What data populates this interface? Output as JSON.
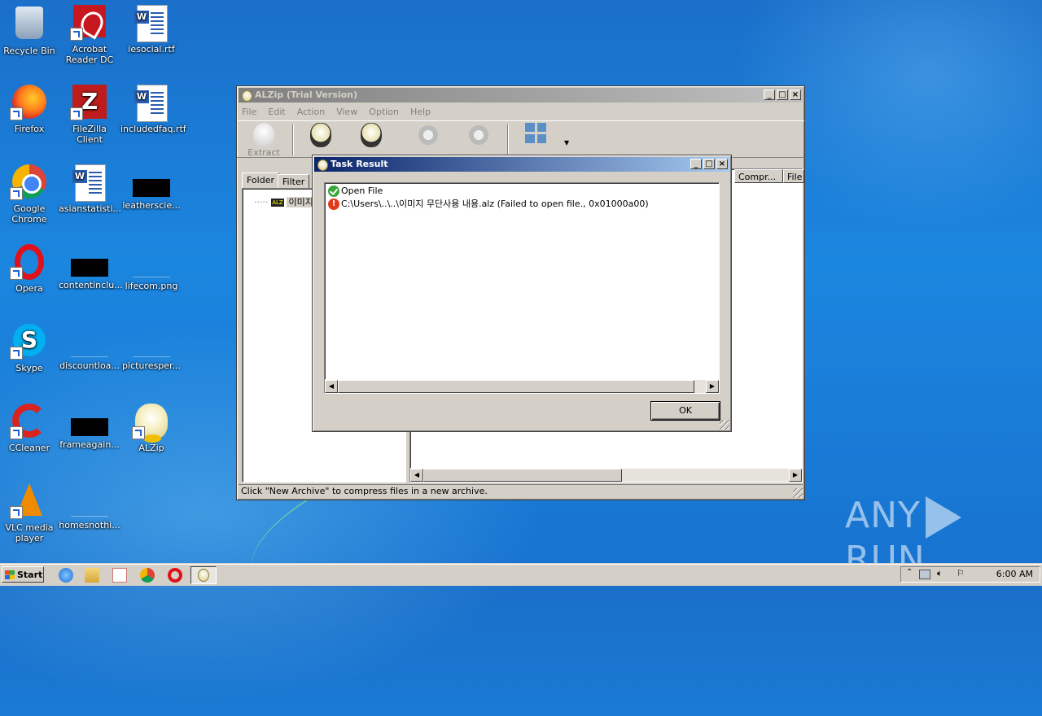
{
  "desktop": {
    "icons": [
      {
        "label": "Recycle Bin",
        "icon": "recycle-bin-icon"
      },
      {
        "label": "Acrobat Reader DC",
        "icon": "acrobat-icon"
      },
      {
        "label": "iesocial.rtf",
        "icon": "word-document-icon"
      },
      {
        "label": "Firefox",
        "icon": "firefox-icon"
      },
      {
        "label": "FileZilla Client",
        "icon": "filezilla-icon"
      },
      {
        "label": "includedfaq.rtf",
        "icon": "word-document-icon"
      },
      {
        "label": "Google Chrome",
        "icon": "chrome-icon"
      },
      {
        "label": "asianstatisti...",
        "icon": "word-document-icon"
      },
      {
        "label": "leatherscie...",
        "icon": "file-icon"
      },
      {
        "label": "Opera",
        "icon": "opera-icon"
      },
      {
        "label": "contentinclu...",
        "icon": "file-icon"
      },
      {
        "label": "lifecom.png",
        "icon": "image-file-icon"
      },
      {
        "label": "Skype",
        "icon": "skype-icon"
      },
      {
        "label": "discountloa...",
        "icon": "file-icon"
      },
      {
        "label": "picturesper...",
        "icon": "file-icon"
      },
      {
        "label": "CCleaner",
        "icon": "ccleaner-icon"
      },
      {
        "label": "frameagain...",
        "icon": "file-icon"
      },
      {
        "label": "ALZip",
        "icon": "alzip-icon"
      },
      {
        "label": "VLC media player",
        "icon": "vlc-icon"
      },
      {
        "label": "homesnothi...",
        "icon": "file-icon"
      }
    ]
  },
  "alzip": {
    "title": "ALZip (Trial Version)",
    "menu": [
      "File",
      "Edit",
      "Action",
      "View",
      "Option",
      "Help"
    ],
    "toolbar": {
      "extract_label": "Extract"
    },
    "tabs": {
      "folder": "Folder",
      "filter": "Filter"
    },
    "tree_item": "이미지",
    "columns": {
      "compressed": "Compr...",
      "file": "File"
    },
    "status": "Click \"New Archive\" to compress files in a new archive."
  },
  "task_result": {
    "title": "Task Result",
    "lines": [
      {
        "status": "ok",
        "text": "Open File"
      },
      {
        "status": "error",
        "text": "C:\\Users\\..\\..\\이미지 무단사용 내용.alz (Failed to open file., 0x01000a00)"
      }
    ],
    "ok_label": "OK"
  },
  "taskbar": {
    "start_label": "Start",
    "quick_launch": [
      "internet-explorer-icon",
      "explorer-icon",
      "media-player-icon",
      "chrome-icon",
      "opera-icon"
    ],
    "clock": "6:00 AM"
  },
  "watermark": {
    "left": "ANY",
    "right": "RUN"
  }
}
